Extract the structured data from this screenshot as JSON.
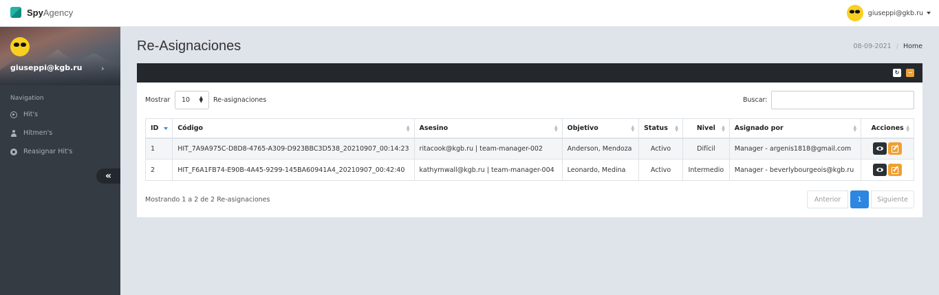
{
  "brand": {
    "bold": "Spy",
    "light": "Agency"
  },
  "topbar": {
    "user_email": "giuseppi@gkb.ru"
  },
  "sidebar": {
    "profile_email": "giuseppi@kgb.ru",
    "profile_chevron": "›",
    "nav_heading": "Navigation",
    "items": [
      {
        "label": "Hit's",
        "icon": "crosshair-icon"
      },
      {
        "label": "Hitmen's",
        "icon": "user-icon"
      },
      {
        "label": "Reasignar Hit's",
        "icon": "dot-circle-icon"
      }
    ],
    "collapse_glyph": "«"
  },
  "page": {
    "title": "Re-Asignaciones",
    "breadcrumb": {
      "date": "08-09-2021",
      "separator": "/",
      "home": "Home"
    }
  },
  "card": {
    "tools": {
      "refresh": "↻",
      "minimize": "−"
    },
    "length": {
      "label": "Mostrar",
      "value": "10",
      "suffix": "Re-asignaciones"
    },
    "search": {
      "label": "Buscar:",
      "value": ""
    },
    "columns": [
      "ID",
      "Código",
      "Asesino",
      "Objetivo",
      "Status",
      "Nivel",
      "Asignado por",
      "Acciones"
    ],
    "rows": [
      {
        "id": "1",
        "codigo": "HIT_7A9A975C-D8D8-4765-A309-D923BBC3D538_20210907_00:14:23",
        "asesino": "ritacook@kgb.ru | team-manager-002",
        "objetivo": "Anderson, Mendoza",
        "status": "Activo",
        "nivel": "Difícil",
        "asignado": "Manager - argenis1818@gmail.com"
      },
      {
        "id": "2",
        "codigo": "HIT_F6A1FB74-E90B-4A45-9299-145BA60941A4_20210907_00:42:40",
        "asesino": "kathyrnwall@kgb.ru | team-manager-004",
        "objetivo": "Leonardo, Medina",
        "status": "Activo",
        "nivel": "Intermedio",
        "asignado": "Manager - beverlybourgeois@kgb.ru"
      }
    ],
    "info": "Mostrando 1 a 2 de 2 Re-asignaciones",
    "pager": {
      "prev": "Anterior",
      "page": "1",
      "next": "Siguiente"
    }
  },
  "colors": {
    "accent": "#2d86e0",
    "warning": "#f0a030",
    "sidebar_bg": "#353b43",
    "header_dark": "#24282d"
  }
}
